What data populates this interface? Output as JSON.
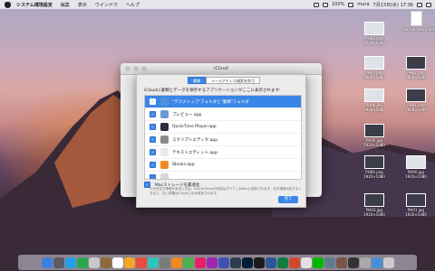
{
  "menubar": {
    "app": "システム環境設定",
    "items": [
      "編集",
      "表示",
      "ウインドウ",
      "ヘルプ"
    ],
    "battery": "100%",
    "user": "mura",
    "datetime": "7月13日(水) 17:36"
  },
  "desktop_icons": [
    {
      "label": "PH08.png",
      "sub": "1920×1080",
      "dark": false
    },
    {
      "label": "PH07.png",
      "sub": "1920×1080",
      "dark": false
    },
    {
      "label": "PH06.JPG",
      "sub": "1920×1080",
      "dark": false
    },
    {
      "label": "PH05.jpg",
      "sub": "1920×1080",
      "dark": true
    },
    {
      "label": "PH04.png",
      "sub": "1920×1080",
      "dark": true
    },
    {
      "label": "PH03.jpg",
      "sub": "1920×1080",
      "dark": true
    },
    {
      "label": "macOS Sierra Beta",
      "sub": "",
      "dark": false,
      "file": true
    },
    {
      "label": "PH02.png",
      "sub": "1920×1080",
      "dark": true
    },
    {
      "label": "PH01.png",
      "sub": "1920×1080",
      "dark": true
    },
    {
      "label": "PH00.jpg",
      "sub": "1920×1080",
      "dark": false
    },
    {
      "label": "PH01.jpg",
      "sub": "1920×1080",
      "dark": true
    }
  ],
  "window": {
    "title": "iCloud"
  },
  "sheet": {
    "tabs": [
      "書類",
      "メールアドレス検索を許可"
    ],
    "header": "iCloudに書類とデータを保存するアプリケーションがここに表示されます:",
    "rows": [
      {
        "label": "\"デスクトップ\"フォルダと\"書類\"フォルダ",
        "selected": true,
        "color": "#4f8fdc"
      },
      {
        "label": "プレビュー.app",
        "selected": false,
        "color": "#6a9ad2"
      },
      {
        "label": "QuickTime Player.app",
        "selected": false,
        "color": "#2b2b3b"
      },
      {
        "label": "スクリプトエディタ.app",
        "selected": false,
        "color": "#8a8a8a"
      },
      {
        "label": "テキストエディット.app",
        "selected": false,
        "color": "#e9e9e9"
      },
      {
        "label": "iBooks.app",
        "selected": false,
        "color": "#f08a1f"
      },
      {
        "label": "",
        "selected": false,
        "color": "#d8d8d8"
      }
    ],
    "optimize_label": "Macストレージを最適化",
    "optimize_note": "十分な空き領域があるときは、iCloud Driveの内容はすべてこのMacに保存されます。空き領域が足りなくなると、古い書類はiCloudにのみ保存されます。",
    "done_label": "完了"
  },
  "dock": {
    "colors": [
      "#3b7fe0",
      "#5c5c66",
      "#28a0e8",
      "#2aa84a",
      "#c9c9c9",
      "#8e6a3a",
      "#ffffff",
      "#f5a623",
      "#e94b3c",
      "#2ec4b6",
      "#7a7a7a",
      "#f08a1f",
      "#4caf50",
      "#e91e63",
      "#9c27b0",
      "#3f51b5",
      "#2d3e50",
      "#001e36",
      "#1b1b1b",
      "#2b579a",
      "#107c41",
      "#d24726",
      "#e0e0e0",
      "#00b900",
      "#607d8b",
      "#795548",
      "#333333",
      "#aaaaaa",
      "#4a90d9",
      "#cccccc"
    ]
  }
}
